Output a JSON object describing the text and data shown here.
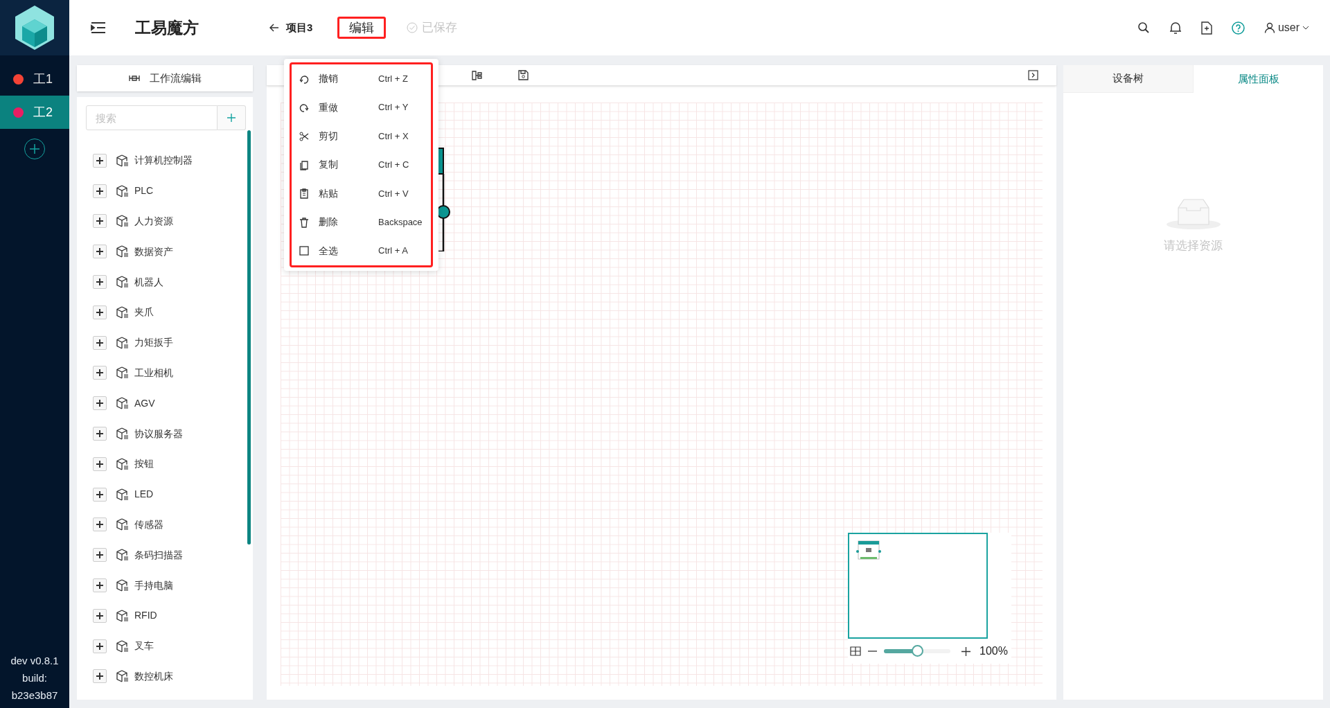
{
  "app": {
    "title": "工易魔方",
    "project": "项目3",
    "edit_menu_label": "编辑",
    "save_status": "已保存",
    "user": "user"
  },
  "workspaces": [
    {
      "label": "工1",
      "color": "#f44336",
      "selected": false
    },
    {
      "label": "工2",
      "color": "#e91e63",
      "selected": true
    }
  ],
  "version": [
    "dev v0.8.1",
    "build:",
    "b23e3b87"
  ],
  "left_panel": {
    "title": "工作流编辑",
    "search": {
      "placeholder": "搜索"
    },
    "items": [
      {
        "label": "计算机控制器",
        "expanded": false
      },
      {
        "label": "PLC",
        "expanded": false
      },
      {
        "label": "人力资源",
        "expanded": false
      },
      {
        "label": "数据资产",
        "expanded": false
      },
      {
        "label": "机器人",
        "expanded": false
      },
      {
        "label": "夹爪",
        "expanded": false
      },
      {
        "label": "力矩扳手",
        "expanded": false
      },
      {
        "label": "工业相机",
        "expanded": false
      },
      {
        "label": "AGV",
        "expanded": false
      },
      {
        "label": "协议服务器",
        "expanded": false
      },
      {
        "label": "按钮",
        "expanded": false
      },
      {
        "label": "LED",
        "expanded": false
      },
      {
        "label": "传感器",
        "expanded": false
      },
      {
        "label": "条码扫描器",
        "expanded": false
      },
      {
        "label": "手持电脑",
        "expanded": false
      },
      {
        "label": "RFID",
        "expanded": false
      },
      {
        "label": "叉车",
        "expanded": false
      },
      {
        "label": "数控机床",
        "expanded": false
      }
    ]
  },
  "edit_menu": [
    {
      "label": "撤销",
      "shortcut": "Ctrl + Z"
    },
    {
      "label": "重做",
      "shortcut": "Ctrl + Y"
    },
    {
      "label": "剪切",
      "shortcut": "Ctrl + X"
    },
    {
      "label": "复制",
      "shortcut": "Ctrl + C"
    },
    {
      "label": "粘贴",
      "shortcut": "Ctrl + V"
    },
    {
      "label": "删除",
      "shortcut": "Backspace"
    },
    {
      "label": "全选",
      "shortcut": "Ctrl + A"
    }
  ],
  "zoom": {
    "level": 0.5,
    "reading": "100%"
  },
  "right_panel": {
    "tabs": [
      {
        "label": "设备树",
        "selected": false
      },
      {
        "label": "属性面板",
        "selected": true
      }
    ],
    "empty_text": "请选择资源"
  }
}
